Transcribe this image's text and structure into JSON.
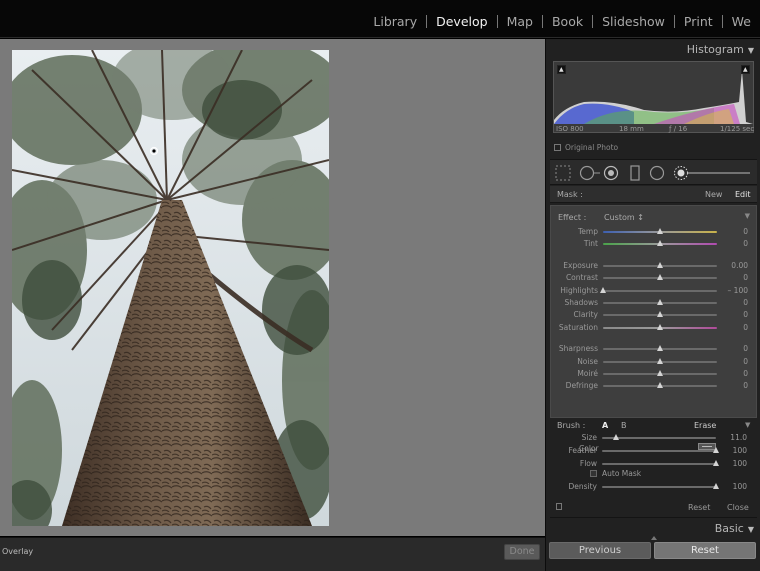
{
  "modules": [
    {
      "label": "Library",
      "active": false
    },
    {
      "label": "Develop",
      "active": true
    },
    {
      "label": "Map",
      "active": false
    },
    {
      "label": "Book",
      "active": false
    },
    {
      "label": "Slideshow",
      "active": false
    },
    {
      "label": "Print",
      "active": false
    },
    {
      "label": "We",
      "active": false
    }
  ],
  "histogram": {
    "title": "Histogram",
    "iso": "ISO 800",
    "focal": "18 mm",
    "aperture": "ƒ / 16",
    "shutter": "1/125 sec",
    "original_photo": "Original Photo"
  },
  "mask": {
    "label": "Mask :",
    "new": "New",
    "edit": "Edit"
  },
  "effect": {
    "label": "Effect :",
    "value": "Custom ↕",
    "groups": [
      [
        {
          "name": "temp",
          "label": "Temp",
          "value": "0",
          "pos": 0.5,
          "track": "temp"
        },
        {
          "name": "tint",
          "label": "Tint",
          "value": "0",
          "pos": 0.5,
          "track": "tint"
        }
      ],
      [
        {
          "name": "exposure",
          "label": "Exposure",
          "value": "0.00",
          "pos": 0.5,
          "track": "plain"
        },
        {
          "name": "contrast",
          "label": "Contrast",
          "value": "0",
          "pos": 0.5,
          "track": "plain"
        },
        {
          "name": "highlights",
          "label": "Highlights",
          "value": "– 100",
          "pos": 0.0,
          "track": "plain"
        },
        {
          "name": "shadows",
          "label": "Shadows",
          "value": "0",
          "pos": 0.5,
          "track": "plain"
        },
        {
          "name": "clarity",
          "label": "Clarity",
          "value": "0",
          "pos": 0.5,
          "track": "plain"
        },
        {
          "name": "saturation",
          "label": "Saturation",
          "value": "0",
          "pos": 0.5,
          "track": "sat"
        }
      ],
      [
        {
          "name": "sharpness",
          "label": "Sharpness",
          "value": "0",
          "pos": 0.5,
          "track": "plain"
        },
        {
          "name": "noise",
          "label": "Noise",
          "value": "0",
          "pos": 0.5,
          "track": "plain"
        },
        {
          "name": "moire",
          "label": "Moiré",
          "value": "0",
          "pos": 0.5,
          "track": "plain"
        },
        {
          "name": "defringe",
          "label": "Defringe",
          "value": "0",
          "pos": 0.5,
          "track": "plain"
        }
      ]
    ],
    "color_label": "Color"
  },
  "brush": {
    "label": "Brush :",
    "a": "A",
    "b": "B",
    "erase": "Erase",
    "sliders": [
      {
        "name": "size",
        "label": "Size",
        "value": "11.0",
        "pos": 0.12
      },
      {
        "name": "feather",
        "label": "Feather",
        "value": "100",
        "pos": 1.0
      },
      {
        "name": "flow",
        "label": "Flow",
        "value": "100",
        "pos": 1.0
      }
    ],
    "auto_mask": "Auto Mask",
    "density": {
      "name": "density",
      "label": "Density",
      "value": "100",
      "pos": 1.0
    }
  },
  "panel_footer": {
    "reset": "Reset",
    "close": "Close"
  },
  "basic": {
    "title": "Basic"
  },
  "buttons": {
    "previous": "Previous",
    "reset": "Reset"
  },
  "toolbar": {
    "overlay": "Overlay",
    "done": "Done"
  }
}
